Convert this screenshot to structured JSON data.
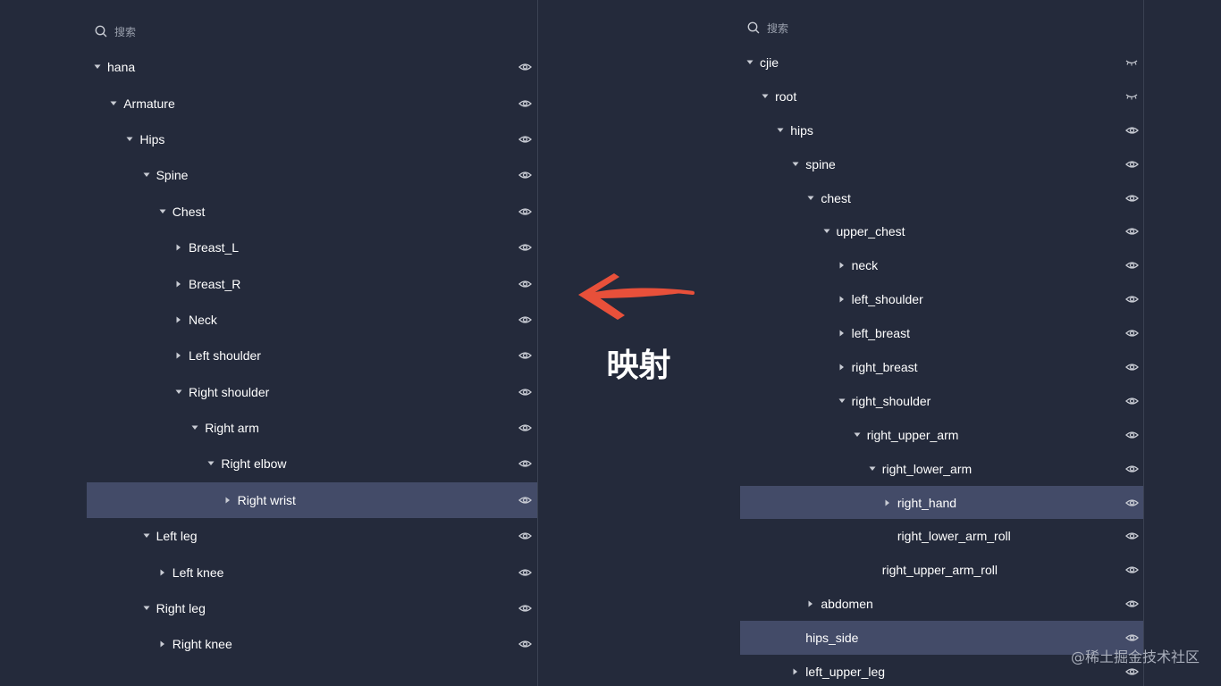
{
  "colors": {
    "background": "#242a3b",
    "selected_row": "#434b68",
    "arrow": "#e8503a",
    "text": "#ffffff",
    "muted": "#9aa0ad"
  },
  "left_panel": {
    "search_placeholder": "搜索",
    "rows": [
      {
        "label": "hana",
        "caret": "down",
        "visibility": "visible"
      },
      {
        "label": "Armature",
        "caret": "down",
        "visibility": "visible"
      },
      {
        "label": "Hips",
        "caret": "down",
        "visibility": "visible"
      },
      {
        "label": "Spine",
        "caret": "down",
        "visibility": "visible"
      },
      {
        "label": "Chest",
        "caret": "down",
        "visibility": "visible"
      },
      {
        "label": "Breast_L",
        "caret": "right",
        "visibility": "visible"
      },
      {
        "label": "Breast_R",
        "caret": "right",
        "visibility": "visible"
      },
      {
        "label": "Neck",
        "caret": "right",
        "visibility": "visible"
      },
      {
        "label": "Left shoulder",
        "caret": "right",
        "visibility": "visible"
      },
      {
        "label": "Right shoulder",
        "caret": "down",
        "visibility": "visible"
      },
      {
        "label": "Right arm",
        "caret": "down",
        "visibility": "visible"
      },
      {
        "label": "Right elbow",
        "caret": "down",
        "visibility": "visible"
      },
      {
        "label": "Right wrist",
        "caret": "right",
        "visibility": "visible",
        "selected": true
      },
      {
        "label": "Left leg",
        "caret": "down",
        "visibility": "visible"
      },
      {
        "label": "Left knee",
        "caret": "right",
        "visibility": "visible"
      },
      {
        "label": "Right leg",
        "caret": "down",
        "visibility": "visible"
      },
      {
        "label": "Right knee",
        "caret": "right",
        "visibility": "visible"
      }
    ]
  },
  "right_panel": {
    "search_placeholder": "搜索",
    "rows": [
      {
        "label": "cjie",
        "caret": "down",
        "visibility": "hidden"
      },
      {
        "label": "root",
        "caret": "down",
        "visibility": "hidden"
      },
      {
        "label": "hips",
        "caret": "down",
        "visibility": "visible"
      },
      {
        "label": "spine",
        "caret": "down",
        "visibility": "visible"
      },
      {
        "label": "chest",
        "caret": "down",
        "visibility": "visible"
      },
      {
        "label": "upper_chest",
        "caret": "down",
        "visibility": "visible"
      },
      {
        "label": "neck",
        "caret": "right",
        "visibility": "visible"
      },
      {
        "label": "left_shoulder",
        "caret": "right",
        "visibility": "visible"
      },
      {
        "label": "left_breast",
        "caret": "right",
        "visibility": "visible"
      },
      {
        "label": "right_breast",
        "caret": "right",
        "visibility": "visible"
      },
      {
        "label": "right_shoulder",
        "caret": "down",
        "visibility": "visible"
      },
      {
        "label": "right_upper_arm",
        "caret": "down",
        "visibility": "visible"
      },
      {
        "label": "right_lower_arm",
        "caret": "down",
        "visibility": "visible"
      },
      {
        "label": "right_hand",
        "caret": "right",
        "visibility": "visible",
        "selected": true
      },
      {
        "label": "right_lower_arm_roll",
        "caret": "none",
        "visibility": "visible"
      },
      {
        "label": "right_upper_arm_roll",
        "caret": "none",
        "visibility": "visible"
      },
      {
        "label": "abdomen",
        "caret": "right",
        "visibility": "visible"
      },
      {
        "label": "hips_side",
        "caret": "none",
        "visibility": "visible",
        "selected": true
      },
      {
        "label": "left_upper_leg",
        "caret": "right",
        "visibility": "visible"
      }
    ]
  },
  "mapping_label": "映射",
  "watermark": "@稀土掘金技术社区"
}
